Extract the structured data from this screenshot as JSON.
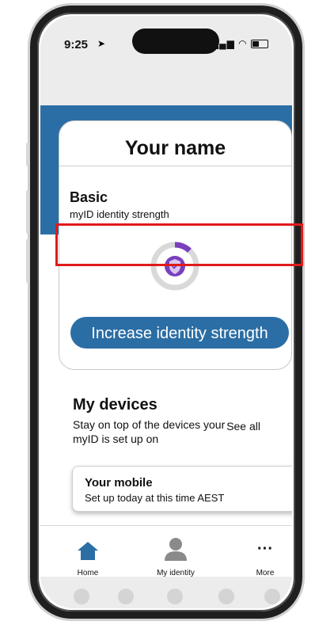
{
  "status_bar": {
    "time": "9:25",
    "icons": "signal wifi battery"
  },
  "identity_card": {
    "name": "Your name",
    "level": "Basic",
    "subtitle": "myID identity strength",
    "strength_fraction": 0.12,
    "button_label": "Increase identity strength"
  },
  "devices": {
    "title": "My devices",
    "description": "Stay on top of the devices your myID is set up on",
    "see_all": "See all",
    "items": [
      {
        "title": "Your mobile",
        "subtitle": "Set up today at this time AEST"
      }
    ]
  },
  "nav": {
    "items": [
      {
        "label": "Home",
        "icon": "home-icon"
      },
      {
        "label": "My identity",
        "icon": "person-icon"
      },
      {
        "label": "More",
        "icon": "more-icon"
      }
    ]
  },
  "colors": {
    "brand_blue": "#2b6ea5",
    "accent_purple": "#7a3fbd",
    "highlight_red": "#e11a1a"
  }
}
